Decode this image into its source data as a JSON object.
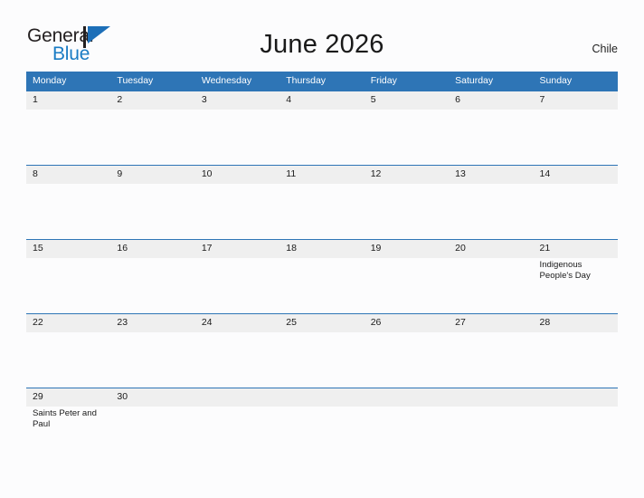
{
  "brand": {
    "name_part1": "General",
    "name_part2": "Blue",
    "flag_icon": "flag-triangle-icon",
    "color_primary": "#1a7cc4",
    "color_text": "#231f20"
  },
  "header": {
    "title": "June 2026",
    "country": "Chile"
  },
  "calendar": {
    "header_bg": "#2e75b6",
    "daynum_bg": "#efefef",
    "weekday_headers": [
      "Monday",
      "Tuesday",
      "Wednesday",
      "Thursday",
      "Friday",
      "Saturday",
      "Sunday"
    ],
    "weeks": [
      [
        {
          "day": "1",
          "events": []
        },
        {
          "day": "2",
          "events": []
        },
        {
          "day": "3",
          "events": []
        },
        {
          "day": "4",
          "events": []
        },
        {
          "day": "5",
          "events": []
        },
        {
          "day": "6",
          "events": []
        },
        {
          "day": "7",
          "events": []
        }
      ],
      [
        {
          "day": "8",
          "events": []
        },
        {
          "day": "9",
          "events": []
        },
        {
          "day": "10",
          "events": []
        },
        {
          "day": "11",
          "events": []
        },
        {
          "day": "12",
          "events": []
        },
        {
          "day": "13",
          "events": []
        },
        {
          "day": "14",
          "events": []
        }
      ],
      [
        {
          "day": "15",
          "events": []
        },
        {
          "day": "16",
          "events": []
        },
        {
          "day": "17",
          "events": []
        },
        {
          "day": "18",
          "events": []
        },
        {
          "day": "19",
          "events": []
        },
        {
          "day": "20",
          "events": []
        },
        {
          "day": "21",
          "events": [
            "Indigenous People's Day"
          ]
        }
      ],
      [
        {
          "day": "22",
          "events": []
        },
        {
          "day": "23",
          "events": []
        },
        {
          "day": "24",
          "events": []
        },
        {
          "day": "25",
          "events": []
        },
        {
          "day": "26",
          "events": []
        },
        {
          "day": "27",
          "events": []
        },
        {
          "day": "28",
          "events": []
        }
      ],
      [
        {
          "day": "29",
          "events": [
            "Saints Peter and Paul"
          ]
        },
        {
          "day": "30",
          "events": []
        },
        {
          "day": "",
          "events": []
        },
        {
          "day": "",
          "events": []
        },
        {
          "day": "",
          "events": []
        },
        {
          "day": "",
          "events": []
        },
        {
          "day": "",
          "events": []
        }
      ]
    ]
  }
}
